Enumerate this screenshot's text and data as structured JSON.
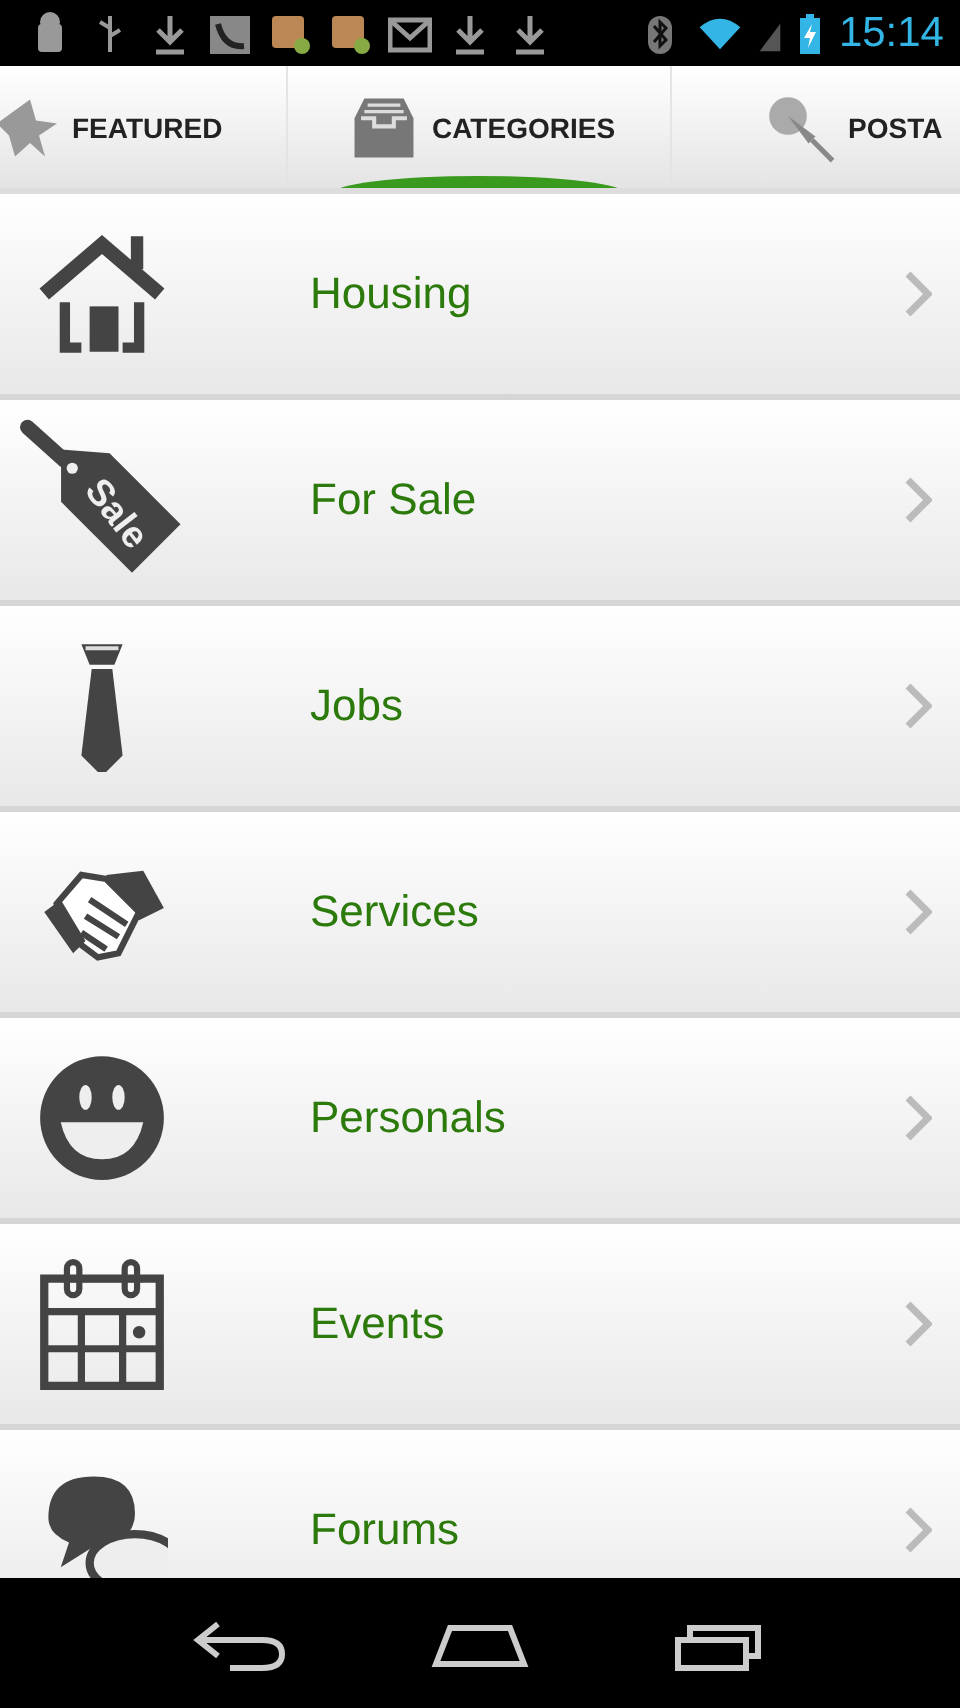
{
  "status_bar": {
    "time": "15:14"
  },
  "tabs": [
    {
      "label": "FEATURED",
      "kind": "star",
      "selected": false
    },
    {
      "label": "CATEGORIES",
      "kind": "tray",
      "selected": true
    },
    {
      "label": "POSTA",
      "kind": "pin",
      "selected": false
    }
  ],
  "categories": [
    {
      "label": "Housing",
      "kind": "house"
    },
    {
      "label": "For Sale",
      "kind": "tag",
      "icon_text": "Sale"
    },
    {
      "label": "Jobs",
      "kind": "tie"
    },
    {
      "label": "Services",
      "kind": "handshake"
    },
    {
      "label": "Personals",
      "kind": "smiley"
    },
    {
      "label": "Events",
      "kind": "calendar"
    },
    {
      "label": "Forums",
      "kind": "bubbles"
    }
  ]
}
